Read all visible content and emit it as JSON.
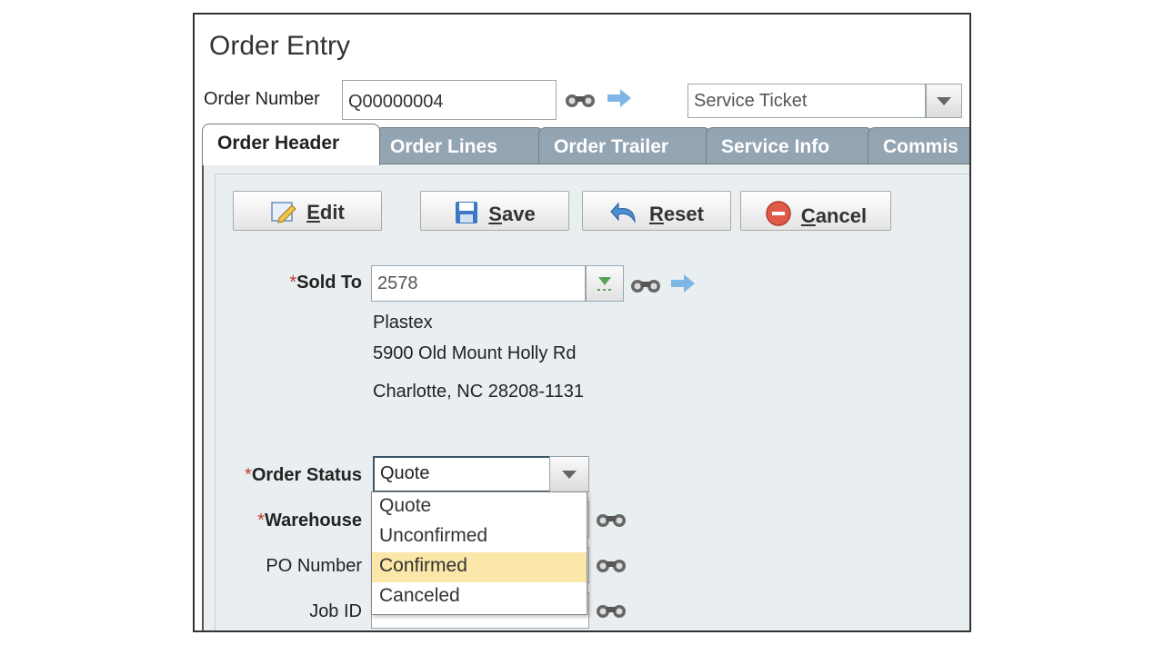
{
  "window": {
    "title": "Order Entry"
  },
  "order_number": {
    "label": "Order Number",
    "value": "Q00000004"
  },
  "order_type": {
    "value": "Service Ticket"
  },
  "tabs": [
    {
      "label": "Order Header",
      "active": true
    },
    {
      "label": "Order Lines"
    },
    {
      "label": "Order Trailer"
    },
    {
      "label": "Service Info"
    },
    {
      "label": "Commis"
    }
  ],
  "toolbar": {
    "edit_label": "dit",
    "edit_mnemonic": "E",
    "save_label": "ave",
    "save_mnemonic": "S",
    "reset_label": "eset",
    "reset_mnemonic": "R",
    "cancel_label": "ancel",
    "cancel_mnemonic": "C"
  },
  "sold_to": {
    "label": "Sold To",
    "required_mark": "*",
    "value": "2578",
    "name": "Plastex",
    "address1": "5900 Old Mount Holly Rd",
    "address2": "Charlotte, NC 28208-1131"
  },
  "order_status": {
    "label": "Order Status",
    "required_mark": "*",
    "value": "Quote",
    "options": [
      "Quote",
      "Unconfirmed",
      "Confirmed",
      "Canceled"
    ],
    "highlighted": "Confirmed"
  },
  "warehouse": {
    "label": "Warehouse",
    "required_mark": "*"
  },
  "po_number": {
    "label": "PO Number"
  },
  "job_id": {
    "label": "Job ID"
  },
  "colors": {
    "tab_inactive": "#93a4b3",
    "panel_bg": "#e9eef1",
    "highlight": "#fbe7a9",
    "arrow": "#7fb6e6",
    "required": "#c0392b"
  }
}
